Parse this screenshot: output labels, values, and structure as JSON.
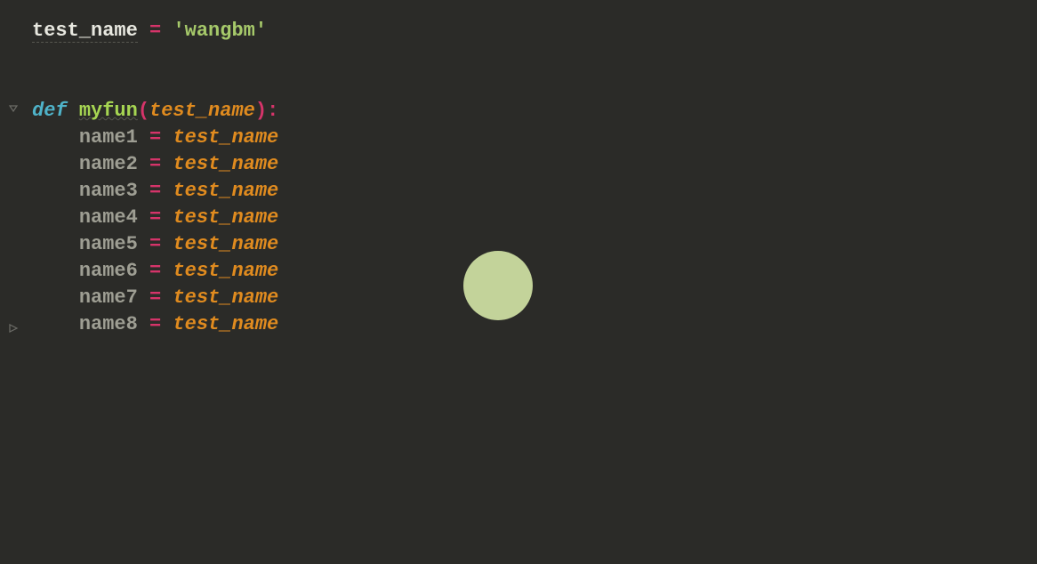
{
  "code": {
    "line1": {
      "varname": "test_name",
      "op": "=",
      "quote_l": "'",
      "string": "wangbm",
      "quote_r": "'"
    },
    "def_line": {
      "keyword": "def",
      "funcname": "myfun",
      "paren_l": "(",
      "param": "test_name",
      "paren_r": ")",
      "colon": ":"
    },
    "assigns": [
      {
        "lhs": "name1",
        "op": "=",
        "rhs": "test_name"
      },
      {
        "lhs": "name2",
        "op": "=",
        "rhs": "test_name"
      },
      {
        "lhs": "name3",
        "op": "=",
        "rhs": "test_name"
      },
      {
        "lhs": "name4",
        "op": "=",
        "rhs": "test_name"
      },
      {
        "lhs": "name5",
        "op": "=",
        "rhs": "test_name"
      },
      {
        "lhs": "name6",
        "op": "=",
        "rhs": "test_name"
      },
      {
        "lhs": "name7",
        "op": "=",
        "rhs": "test_name"
      },
      {
        "lhs": "name8",
        "op": "=",
        "rhs": "test_name"
      }
    ]
  },
  "cursor": {
    "visible": true
  }
}
